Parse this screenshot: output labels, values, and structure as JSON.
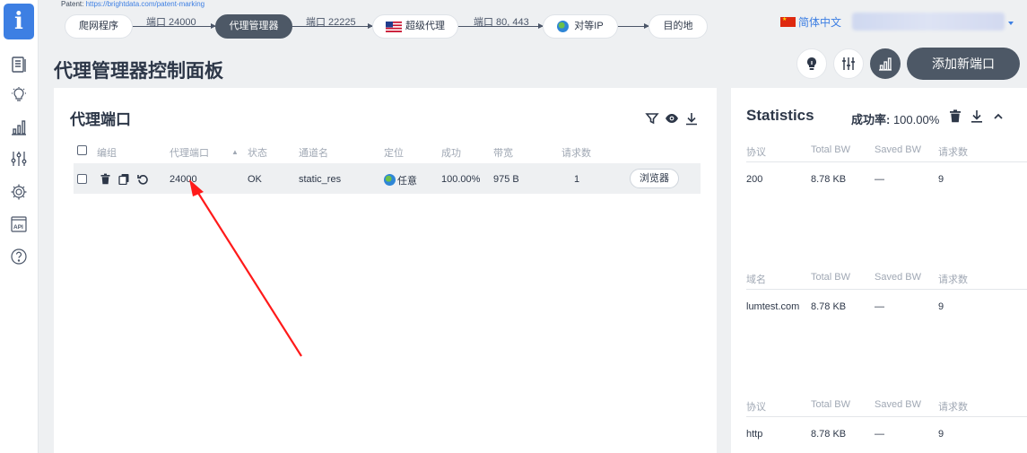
{
  "app": {
    "logo_glyph": "i",
    "patent_prefix": "Patent: ",
    "patent_link": "https://brightdata.com/patent-marking"
  },
  "sidebar": {
    "items": [
      {
        "icon": "list-icon"
      },
      {
        "icon": "lightbulb-icon"
      },
      {
        "icon": "bar-chart-icon"
      },
      {
        "icon": "sliders-icon"
      },
      {
        "icon": "gear-icon"
      },
      {
        "icon": "api-icon"
      },
      {
        "icon": "help-icon"
      }
    ]
  },
  "flow": {
    "nodes": [
      "爬网程序",
      "代理管理器",
      "超级代理",
      "对等IP",
      "目的地"
    ],
    "links": [
      "端口 24000",
      "端口 22225",
      "端口 80, 443",
      ""
    ]
  },
  "language": {
    "label": "简体中文"
  },
  "header": {
    "title": "代理管理器控制面板",
    "add_port": "添加新端口"
  },
  "proxy_panel": {
    "title": "代理端口",
    "columns": [
      "编组",
      "代理端口",
      "状态",
      "通道名",
      "定位",
      "成功",
      "带宽",
      "请求数"
    ],
    "rows": [
      {
        "port": "24000",
        "status": "OK",
        "zone": "static_res",
        "location": "任意",
        "success": "100.00%",
        "bandwidth": "975 B",
        "requests": "1",
        "action": "浏览器"
      }
    ]
  },
  "stats_panel": {
    "title": "Statistics",
    "rate_label": "成功率: ",
    "rate_value": "100.00%",
    "tables": [
      {
        "headers": [
          "协议",
          "Total BW",
          "Saved BW",
          "请求数"
        ],
        "row": [
          "200",
          "8.78 KB",
          "—",
          "9"
        ]
      },
      {
        "headers": [
          "域名",
          "Total BW",
          "Saved BW",
          "请求数"
        ],
        "row": [
          "lumtest.com",
          "8.78 KB",
          "—",
          "9"
        ]
      },
      {
        "headers": [
          "协议",
          "Total BW",
          "Saved BW",
          "请求数"
        ],
        "row": [
          "http",
          "8.78 KB",
          "—",
          "9"
        ]
      }
    ]
  },
  "colors": {
    "accent": "#3d7fe3",
    "dark_button": "#4d5866",
    "annotation_arrow": "#ff1a1a"
  }
}
